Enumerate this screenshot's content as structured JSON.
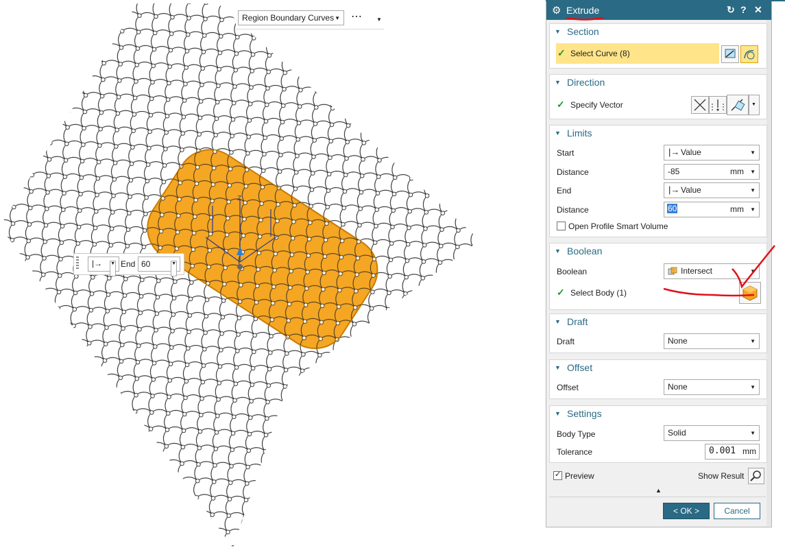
{
  "selection_bar": {
    "filter_value": "Region Boundary Curves",
    "more_label": "⋯"
  },
  "canvas_handle": {
    "option_symbol": "|→",
    "end_label": "End",
    "end_value": "60"
  },
  "dialog": {
    "title": "Extrude",
    "reset_label": "↻",
    "help_label": "?",
    "close_label": "✕",
    "section": {
      "title": "Section",
      "select_curve": "Select Curve (8)"
    },
    "direction": {
      "title": "Direction",
      "specify_vector": "Specify Vector"
    },
    "limits": {
      "title": "Limits",
      "start_label": "Start",
      "start_option_symbol": "|→",
      "start_option": "Value",
      "start_distance_label": "Distance",
      "start_distance_value": "-85",
      "start_distance_unit": "mm",
      "end_label": "End",
      "end_option_symbol": "|→",
      "end_option": "Value",
      "end_distance_label": "Distance",
      "end_distance_value": "60",
      "end_distance_unit": "mm",
      "open_profile_label": "Open Profile Smart Volume"
    },
    "boolean": {
      "title": "Boolean",
      "boolean_label": "Boolean",
      "boolean_value": "Intersect",
      "select_body": "Select Body (1)"
    },
    "draft": {
      "title": "Draft",
      "draft_label": "Draft",
      "draft_value": "None"
    },
    "offset": {
      "title": "Offset",
      "offset_label": "Offset",
      "offset_value": "None"
    },
    "settings": {
      "title": "Settings",
      "body_type_label": "Body Type",
      "body_type_value": "Solid",
      "tolerance_label": "Tolerance",
      "tolerance_value": "0.001",
      "tolerance_unit": "mm"
    },
    "preview_label": "Preview",
    "show_result_label": "Show Result",
    "ok_label": "< OK >",
    "cancel_label": "Cancel"
  },
  "colors": {
    "accent": "#2a6a84",
    "highlight": "#ffe48a",
    "solid_body": "#f5a623",
    "annotation": "#e0101a",
    "check": "#1f9a2a"
  },
  "icons": [
    "gear-icon",
    "reset-icon",
    "help-icon",
    "close-icon",
    "curve-rule-icon",
    "curve-icon",
    "vector-reverse-icon",
    "vector-icon",
    "inferred-vector-icon",
    "body-select-icon",
    "intersect-icon",
    "magnifier-icon"
  ]
}
